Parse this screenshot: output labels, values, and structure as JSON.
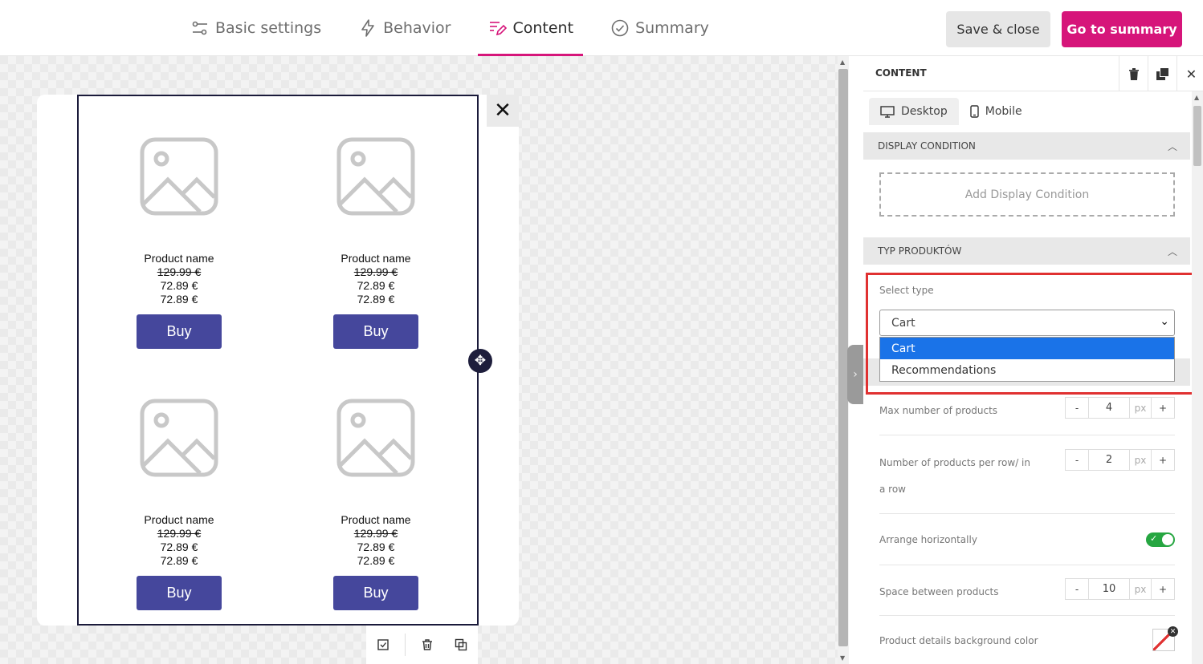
{
  "nav": {
    "tabs": [
      {
        "label": "Basic settings",
        "icon": "sliders-icon"
      },
      {
        "label": "Behavior",
        "icon": "lightning-icon"
      },
      {
        "label": "Content",
        "icon": "content-edit-icon"
      },
      {
        "label": "Summary",
        "icon": "check-circle-icon"
      }
    ],
    "active_tab": "Content",
    "save_close_label": "Save & close",
    "go_summary_label": "Go to summary"
  },
  "colors": {
    "accent": "#d6157a",
    "buy_button": "#45479c",
    "highlight": "#e03131",
    "selected_option": "#1a73e8",
    "toggle_on": "#26a641"
  },
  "canvas": {
    "close_glyph": "✕",
    "products": [
      {
        "name": "Product name",
        "old_price": "129.99 €",
        "price1": "72.89 €",
        "price2": "72.89 €",
        "button": "Buy"
      },
      {
        "name": "Product name",
        "old_price": "129.99 €",
        "price1": "72.89 €",
        "price2": "72.89 €",
        "button": "Buy"
      },
      {
        "name": "Product name",
        "old_price": "129.99 €",
        "price1": "72.89 €",
        "price2": "72.89 €",
        "button": "Buy"
      },
      {
        "name": "Product name",
        "old_price": "129.99 €",
        "price1": "72.89 €",
        "price2": "72.89 €",
        "button": "Buy"
      }
    ]
  },
  "panel": {
    "title": "CONTENT",
    "device_tabs": [
      {
        "label": "Desktop",
        "active": true
      },
      {
        "label": "Mobile",
        "active": false
      }
    ],
    "display_condition": {
      "header": "DISPLAY CONDITION",
      "add_label": "Add Display Condition"
    },
    "product_type": {
      "header": "TYP PRODUKTÓW",
      "select_label": "Select type",
      "selected": "Cart",
      "options": [
        "Cart",
        "Recommendations"
      ]
    },
    "settings": {
      "max_products": {
        "label": "Max number of products",
        "value": "4",
        "unit": "px"
      },
      "per_row": {
        "label_line1": "Number of products per row/ in",
        "label_line2": "a row",
        "value": "2",
        "unit": "px"
      },
      "arrange": {
        "label": "Arrange horizontally",
        "on": true
      },
      "space": {
        "label": "Space between products",
        "value": "10",
        "unit": "px"
      },
      "bg_color": {
        "label": "Product details background color"
      },
      "minus": "-",
      "plus": "+"
    }
  }
}
